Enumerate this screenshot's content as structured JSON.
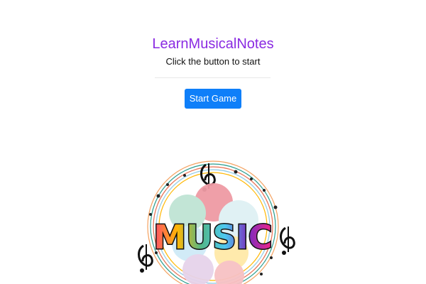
{
  "app": {
    "title": "LearnMusicalNotes",
    "subtitle": "Click the button to start",
    "start_button_label": "Start Game"
  },
  "logo": {
    "icon": "music-logo",
    "text": "MUSIC",
    "colors": {
      "accent": "#8a2be2",
      "button": "#0f7ff9",
      "circle_pink": "#ef9aa4",
      "circle_green": "#bfe4d4",
      "circle_blue": "#cfeaf7",
      "circle_yellow": "#ffe9a8",
      "circle_purple": "#e6d3ea"
    }
  }
}
